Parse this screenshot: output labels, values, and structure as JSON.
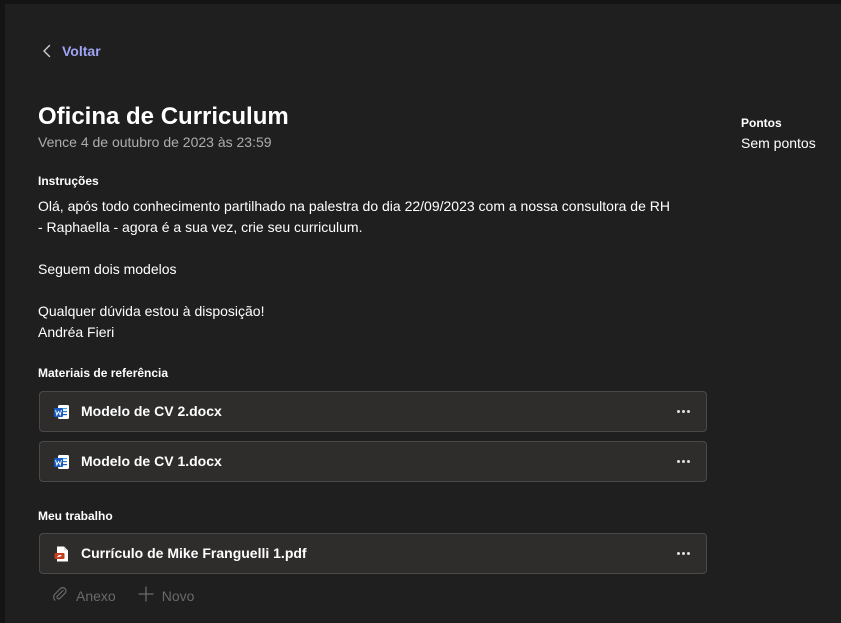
{
  "nav": {
    "back_label": "Voltar"
  },
  "assignment": {
    "title": "Oficina de Curriculum",
    "due": "Vence 4 de outubro de 2023 às 23:59"
  },
  "instructions": {
    "label": "Instruções",
    "line1": "Olá, após todo conhecimento partilhado na palestra do dia 22/09/2023 com a nossa consultora de RH",
    "line2": "- Raphaella - agora é a sua vez, crie seu curriculum.",
    "line3": "Seguem dois modelos",
    "line4": "Qualquer dúvida estou à disposição!",
    "line5": "Andréa Fieri"
  },
  "reference": {
    "label": "Materiais de referência",
    "files": [
      {
        "name": "Modelo de CV 2.docx",
        "icon": "word-file-icon"
      },
      {
        "name": "Modelo de CV 1.docx",
        "icon": "word-file-icon"
      }
    ]
  },
  "my_work": {
    "label": "Meu trabalho",
    "files": [
      {
        "name": "Currículo de Mike Franguelli 1.pdf",
        "icon": "pdf-file-icon"
      }
    ],
    "attach_label": "Anexo",
    "new_label": "Novo"
  },
  "points": {
    "label": "Pontos",
    "value": "Sem pontos"
  },
  "colors": {
    "accent": "#9fa3f5",
    "background": "#1f1f1f",
    "card": "#2e2d2c",
    "word_blue": "#185abd",
    "pdf_red": "#c43e1c"
  }
}
